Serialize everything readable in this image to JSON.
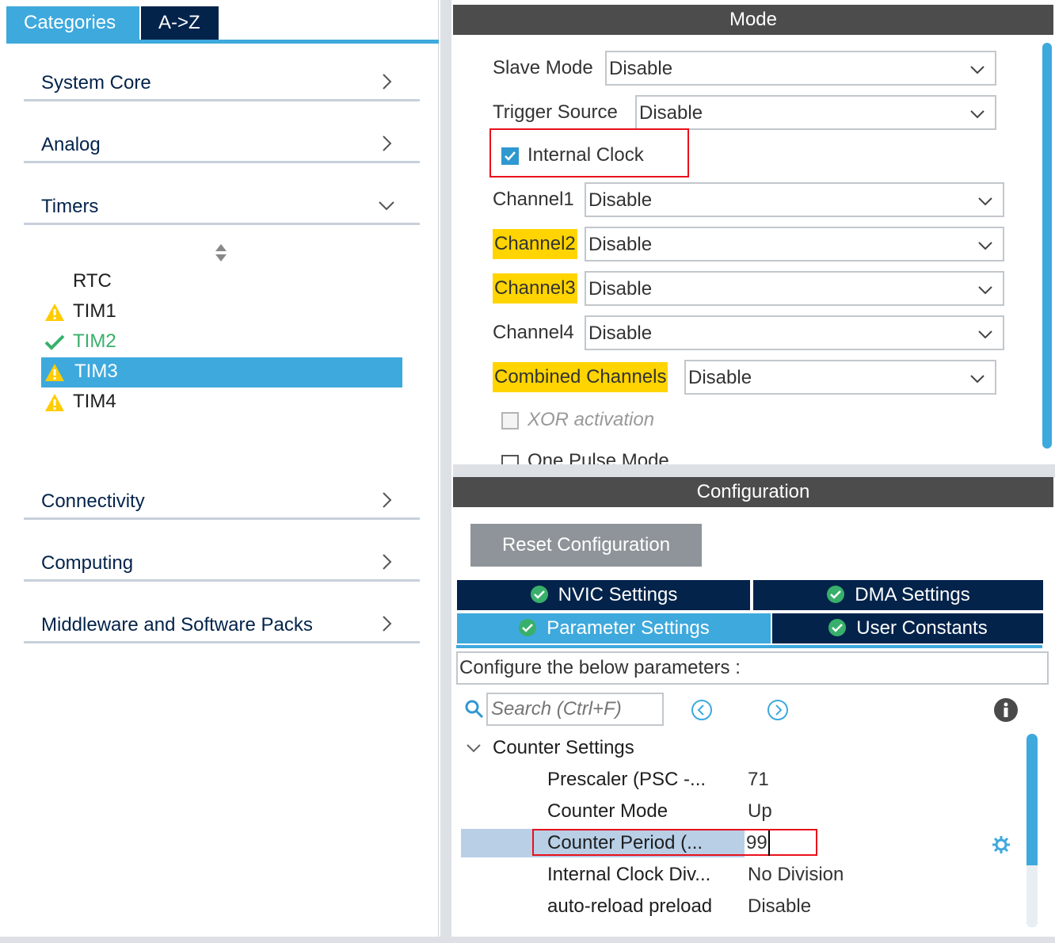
{
  "left": {
    "tabs": [
      {
        "label": "Categories",
        "active": true
      },
      {
        "label": "A->Z",
        "active": false
      }
    ],
    "categories": {
      "system_core": "System Core",
      "analog": "Analog",
      "timers": "Timers",
      "connectivity": "Connectivity",
      "computing": "Computing",
      "middleware": "Middleware and Software Packs"
    },
    "timers_items": [
      {
        "label": "RTC",
        "status": "none"
      },
      {
        "label": "TIM1",
        "status": "warning"
      },
      {
        "label": "TIM2",
        "status": "ok"
      },
      {
        "label": "TIM3",
        "status": "warning",
        "selected": true
      },
      {
        "label": "TIM4",
        "status": "warning"
      }
    ]
  },
  "mode": {
    "title": "Mode",
    "slave_mode": {
      "label": "Slave Mode",
      "value": "Disable"
    },
    "trigger_source": {
      "label": "Trigger Source",
      "value": "Disable"
    },
    "internal_clock": {
      "label": "Internal Clock",
      "checked": true
    },
    "channel1": {
      "label": "Channel1",
      "value": "Disable"
    },
    "channel2": {
      "label": "Channel2",
      "value": "Disable"
    },
    "channel3": {
      "label": "Channel3",
      "value": "Disable"
    },
    "channel4": {
      "label": "Channel4",
      "value": "Disable"
    },
    "combined": {
      "label": "Combined Channels",
      "value": "Disable"
    },
    "xor": {
      "label": "XOR activation",
      "checked": false
    },
    "one_pulse": {
      "label": "One Pulse Mode",
      "checked": false
    }
  },
  "config": {
    "title": "Configuration",
    "reset_label": "Reset Configuration",
    "tabs": {
      "nvic": "NVIC Settings",
      "dma": "DMA Settings",
      "params": "Parameter Settings",
      "user": "User Constants"
    },
    "description": "Configure the below parameters :",
    "search_placeholder": "Search (Ctrl+F)",
    "group": "Counter Settings",
    "params": [
      {
        "name": "Prescaler (PSC -...",
        "value": "71"
      },
      {
        "name": "Counter Mode",
        "value": "Up"
      },
      {
        "name": "Counter Period (...",
        "value": "99"
      },
      {
        "name": "Internal Clock Div...",
        "value": "No Division"
      },
      {
        "name": "auto-reload preload",
        "value": "Disable"
      }
    ]
  },
  "colors": {
    "accent": "#3ea9dd",
    "navy": "#03234b",
    "header": "#4c4c4c",
    "highlight": "#ffd400",
    "warning": "#ffcc00",
    "ok": "#38b06b",
    "red": "#e8111b"
  }
}
